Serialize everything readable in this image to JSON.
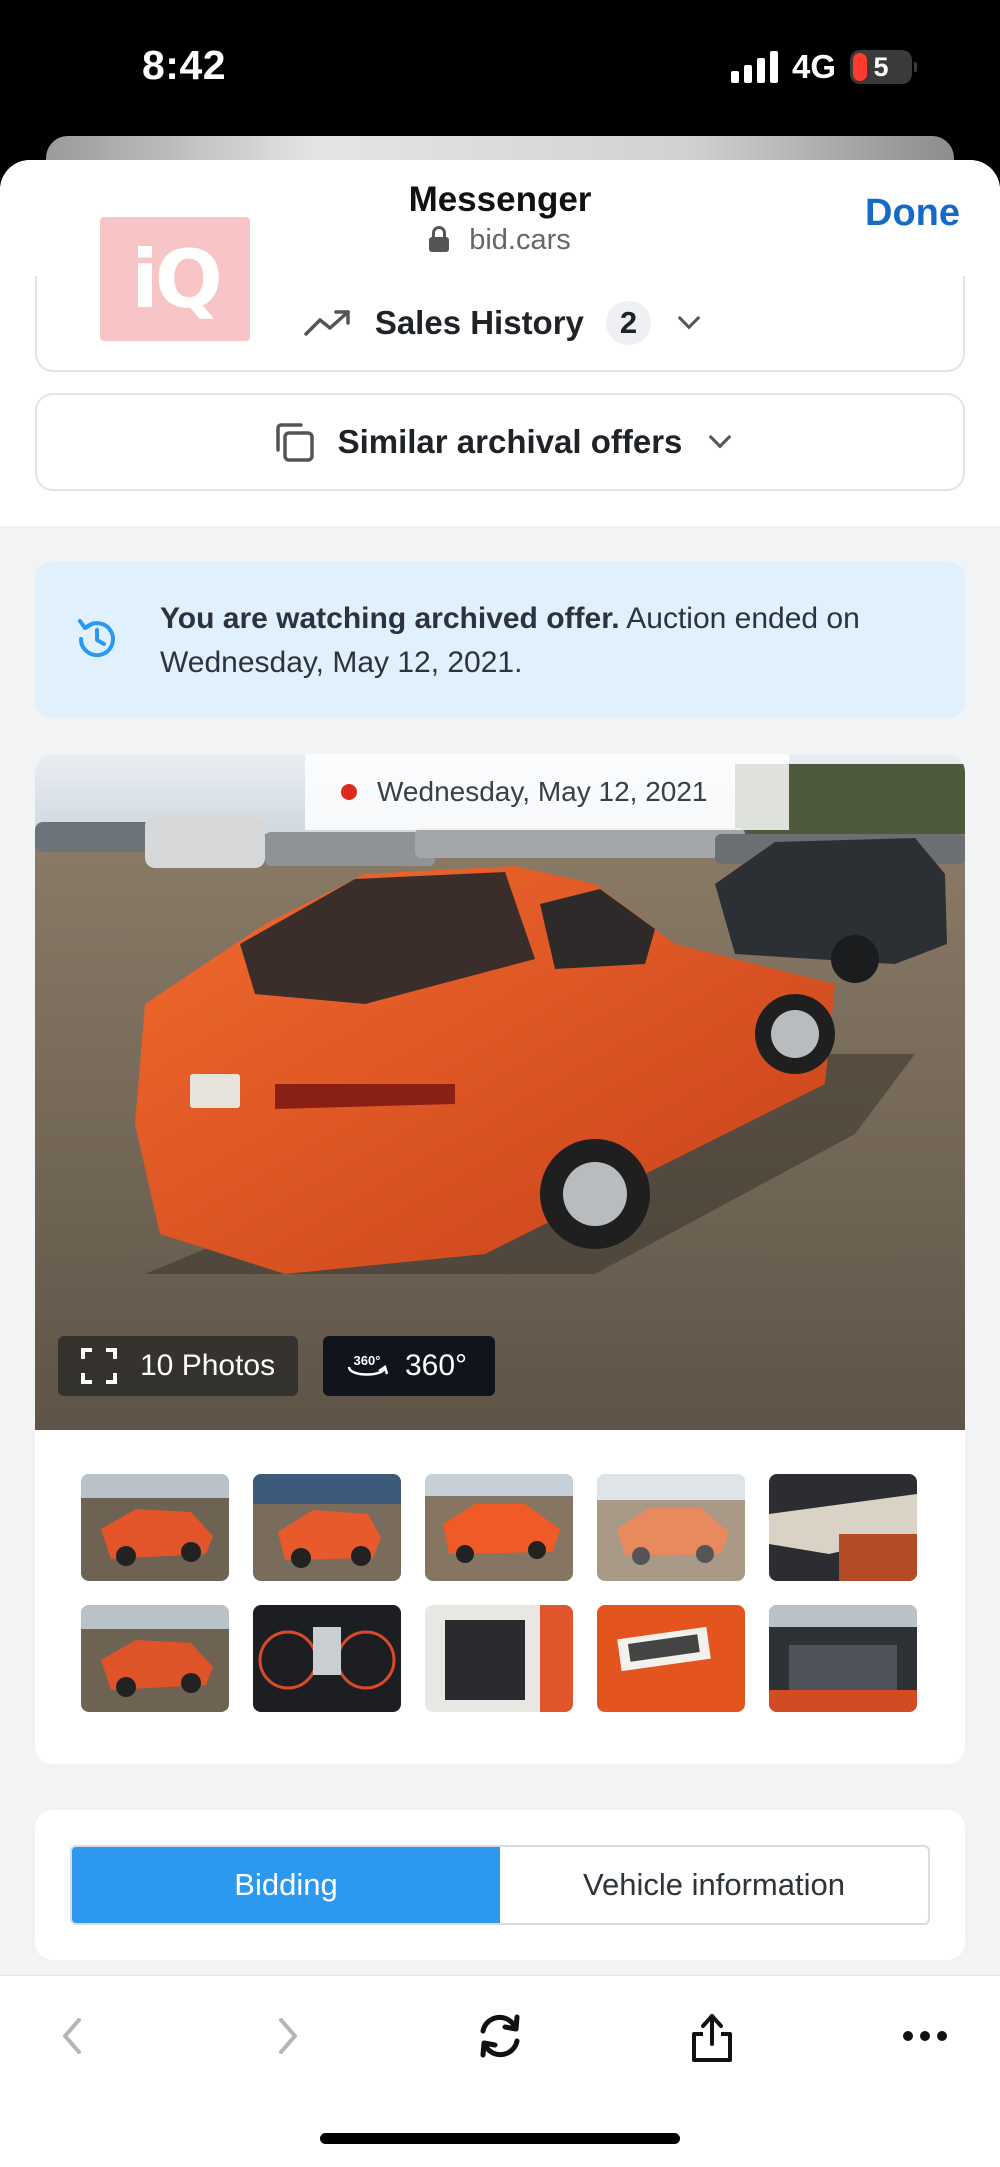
{
  "status_bar": {
    "time": "8:42",
    "network": "4G",
    "battery": "5"
  },
  "header": {
    "title": "Messenger",
    "url": "bid.cars",
    "done_label": "Done"
  },
  "logo": {
    "text": "iQ"
  },
  "accordions": {
    "sales_history": {
      "label": "Sales History",
      "count": "2",
      "icon": "trend-up-icon"
    },
    "similar": {
      "label": "Similar archival offers",
      "icon": "copy-icon"
    }
  },
  "notice": {
    "bold": "You are watching archived offer.",
    "rest": " Auction ended on Wednesday, May 12, 2021."
  },
  "gallery": {
    "date": "Wednesday, May 12, 2021",
    "photos_label": "10 Photos",
    "view360_label": "360°",
    "thumbnails": [
      "front-left",
      "front-left",
      "rear-right",
      "rear-right",
      "interior-dash",
      "front-left",
      "instrument-cluster",
      "interior-rear",
      "label-plate",
      "engine-bay"
    ]
  },
  "tabs": [
    {
      "label": "Bidding",
      "active": true
    },
    {
      "label": "Vehicle information",
      "active": false
    }
  ],
  "toolbar": [
    "back-icon",
    "forward-icon",
    "reload-icon",
    "share-icon",
    "more-icon"
  ],
  "colors": {
    "accent_blue": "#2d98f0",
    "link_blue": "#1569c7",
    "notice_bg": "#e0f0fd",
    "car": "#e0501e"
  }
}
